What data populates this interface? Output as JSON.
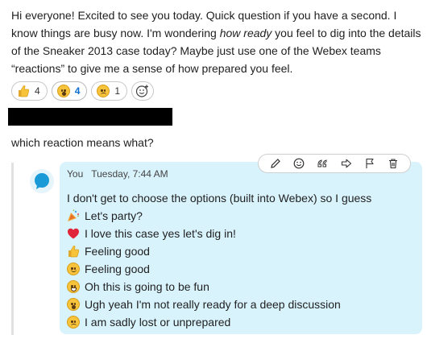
{
  "message": {
    "part1": "Hi everyone! Excited to see you today. Quick question if you have a second. I know things are busy now. I'm wondering ",
    "emphasis": "how ready",
    "part2": " you feel to dig into the details of the Sneaker 2013 case today? Maybe just use one of the Webex teams “reactions” to give me a sense of how prepared you feel."
  },
  "reactions": [
    {
      "icon": "thumbs-up-icon",
      "count": "4"
    },
    {
      "icon": "surprised-face-icon",
      "count": "4"
    },
    {
      "icon": "sad-face-icon",
      "count": "1"
    }
  ],
  "add_reaction_icon": "add-reaction-icon",
  "question": "which reaction means what?",
  "reply": {
    "author": "You",
    "timestamp": "Tuesday, 7:44 AM",
    "lines": [
      {
        "icon": "none",
        "text": "I don't get to choose the options (built into Webex)  so I guess"
      },
      {
        "icon": "party-popper-icon",
        "text": "Let's party?"
      },
      {
        "icon": "red-heart-icon",
        "text": "I love this case yes let's dig in!"
      },
      {
        "icon": "thumbs-up-icon",
        "text": "Feeling good"
      },
      {
        "icon": "smiling-face-icon",
        "text": "Feeling good"
      },
      {
        "icon": "laughing-face-icon",
        "text": "Oh this is going to be fun"
      },
      {
        "icon": "surprised-face-icon",
        "text": "Ugh yeah I'm not really ready for a deep discussion"
      },
      {
        "icon": "sad-face-icon",
        "text": "I am sadly lost or unprepared"
      }
    ]
  },
  "toolbar": [
    "edit-icon",
    "react-icon",
    "quote-icon",
    "forward-icon",
    "flag-icon",
    "delete-icon"
  ],
  "colors": {
    "bubble": "#d9f3fd",
    "accent": "#0a6ed1",
    "redacted": "#000000"
  }
}
